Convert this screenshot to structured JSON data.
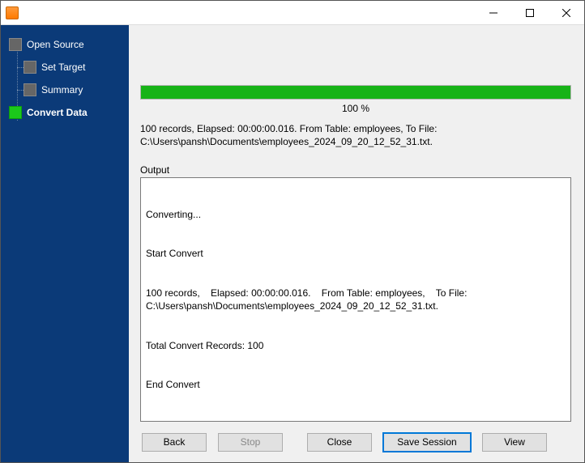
{
  "window": {
    "title": ""
  },
  "sidebar": {
    "steps": [
      {
        "label": "Open Source",
        "active": false,
        "child": false
      },
      {
        "label": "Set Target",
        "active": false,
        "child": true
      },
      {
        "label": "Summary",
        "active": false,
        "child": true
      },
      {
        "label": "Convert Data",
        "active": true,
        "child": false
      }
    ]
  },
  "progress": {
    "percent_label": "100 %",
    "value": 100
  },
  "summary": {
    "line1": "100 records,    Elapsed: 00:00:00.016.    From Table: employees,    To File:",
    "line2": "C:\\Users\\pansh\\Documents\\employees_2024_09_20_12_52_31.txt."
  },
  "output": {
    "label": "Output",
    "lines": [
      "Converting...",
      "Start Convert",
      "100 records,    Elapsed: 00:00:00.016.    From Table: employees,    To File: C:\\Users\\pansh\\Documents\\employees_2024_09_20_12_52_31.txt.",
      "Total Convert Records: 100",
      "End Convert"
    ]
  },
  "buttons": {
    "back": "Back",
    "stop": "Stop",
    "close": "Close",
    "save_session": "Save Session",
    "view": "View"
  }
}
